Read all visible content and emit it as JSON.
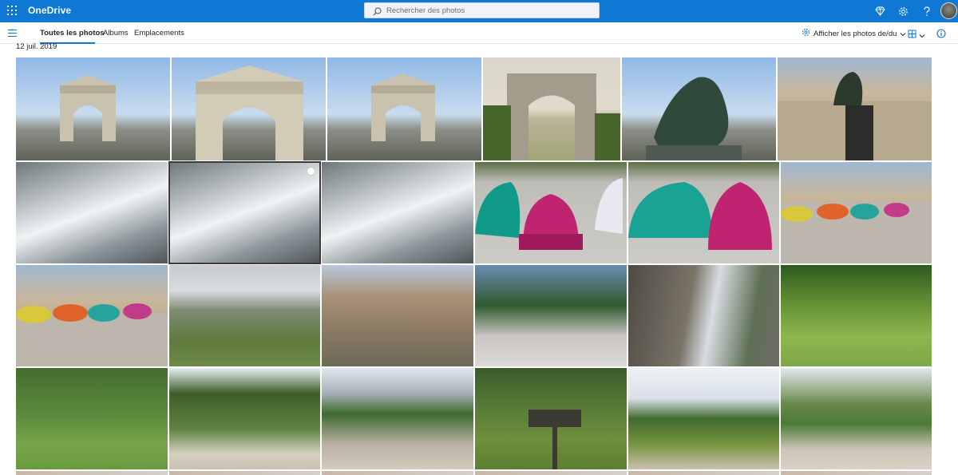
{
  "app": {
    "name": "OneDrive",
    "search_placeholder": "Rechercher des photos"
  },
  "topbar_icons": [
    "diamond-icon",
    "settings-gear-icon",
    "help-question-icon"
  ],
  "nav": {
    "tabs": [
      {
        "label": "Toutes les photos",
        "active": true
      },
      {
        "label": "Albums",
        "active": false
      },
      {
        "label": "Emplacements",
        "active": false
      }
    ],
    "filter_label": "Afficher les photos de/du"
  },
  "date_header": "12 juil. 2019",
  "colors": {
    "brand_blue": "#0f78d4",
    "nav_text": "#252423"
  },
  "photos": [
    {
      "subject": "arc-de-triomphe"
    },
    {
      "subject": "arc-de-triomphe"
    },
    {
      "subject": "arc-de-triomphe"
    },
    {
      "subject": "arc-de-triomphe-tunnel"
    },
    {
      "subject": "quadriga-statue"
    },
    {
      "subject": "monument-statue"
    },
    {
      "subject": "station-roof"
    },
    {
      "subject": "station-roof",
      "selected": true
    },
    {
      "subject": "station-roof"
    },
    {
      "subject": "citroen-2cv"
    },
    {
      "subject": "citroen-2cv"
    },
    {
      "subject": "citroen-2cv-village"
    },
    {
      "subject": "citroen-2cv-village"
    },
    {
      "subject": "valley"
    },
    {
      "subject": "stone-house"
    },
    {
      "subject": "patio"
    },
    {
      "subject": "stone-alley"
    },
    {
      "subject": "garden"
    },
    {
      "subject": "lawn"
    },
    {
      "subject": "lane"
    },
    {
      "subject": "ivy-house"
    },
    {
      "subject": "vineyard-caveau"
    },
    {
      "subject": "cypress-lane"
    },
    {
      "subject": "ivy-house"
    }
  ]
}
